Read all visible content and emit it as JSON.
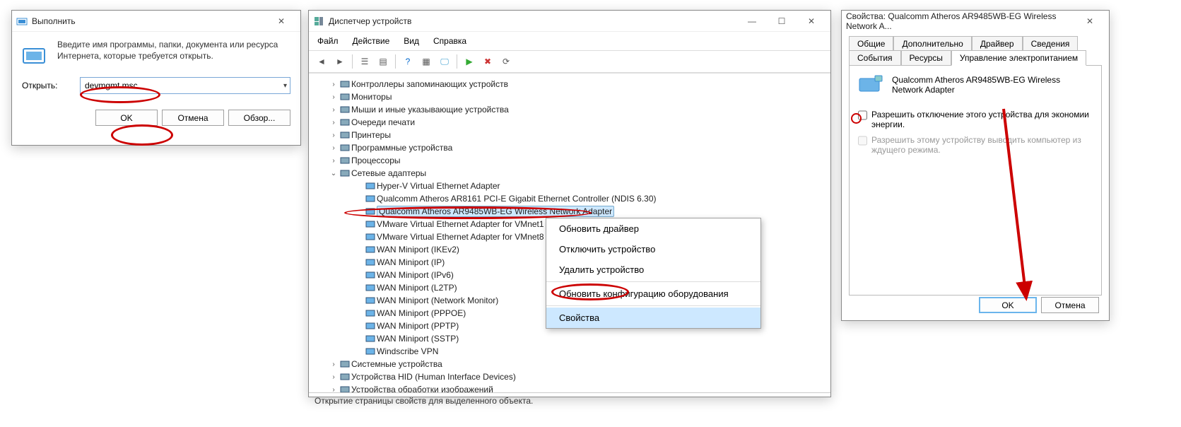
{
  "run": {
    "title": "Выполнить",
    "desc": "Введите имя программы, папки, документа или ресурса Интернета, которые требуется открыть.",
    "open_label": "Открыть:",
    "value": "devmgmt.msc",
    "ok": "OK",
    "cancel": "Отмена",
    "browse": "Обзор..."
  },
  "dm": {
    "title": "Диспетчер устройств",
    "menu": {
      "file": "Файл",
      "action": "Действие",
      "view": "Вид",
      "help": "Справка"
    },
    "top_nodes": [
      "Контроллеры запоминающих устройств",
      "Мониторы",
      "Мыши и иные указывающие устройства",
      "Очереди печати",
      "Принтеры",
      "Программные устройства",
      "Процессоры"
    ],
    "net_label": "Сетевые адаптеры",
    "net_children": [
      "Hyper-V Virtual Ethernet Adapter",
      "Qualcomm Atheros AR8161 PCI-E Gigabit Ethernet Controller (NDIS 6.30)",
      "Qualcomm Atheros AR9485WB-EG Wireless Network Adapter",
      "VMware Virtual Ethernet Adapter for VMnet1",
      "VMware Virtual Ethernet Adapter for VMnet8",
      "WAN Miniport (IKEv2)",
      "WAN Miniport (IP)",
      "WAN Miniport (IPv6)",
      "WAN Miniport (L2TP)",
      "WAN Miniport (Network Monitor)",
      "WAN Miniport (PPPOE)",
      "WAN Miniport (PPTP)",
      "WAN Miniport (SSTP)",
      "Windscribe VPN"
    ],
    "bottom_nodes": [
      "Системные устройства",
      "Устройства HID (Human Interface Devices)",
      "Устройства обработки изображений"
    ],
    "status": "Открытие страницы свойств для выделенного объекта.",
    "ctx": {
      "update": "Обновить драйвер",
      "disable": "Отключить устройство",
      "remove": "Удалить устройство",
      "refresh": "Обновить конфигурацию оборудования",
      "properties": "Свойства"
    }
  },
  "pr": {
    "title": "Свойства: Qualcomm Atheros AR9485WB-EG Wireless Network A...",
    "tabs": {
      "general": "Общие",
      "advanced": "Дополнительно",
      "driver": "Драйвер",
      "details": "Сведения",
      "events": "События",
      "resources": "Ресурсы",
      "power": "Управление электропитанием"
    },
    "device": "Qualcomm Atheros AR9485WB-EG Wireless Network Adapter",
    "chk1": "Разрешить отключение этого устройства для экономии энергии.",
    "chk2": "Разрешить этому устройству выводить компьютер из ждущего режима.",
    "ok": "OK",
    "cancel": "Отмена"
  }
}
